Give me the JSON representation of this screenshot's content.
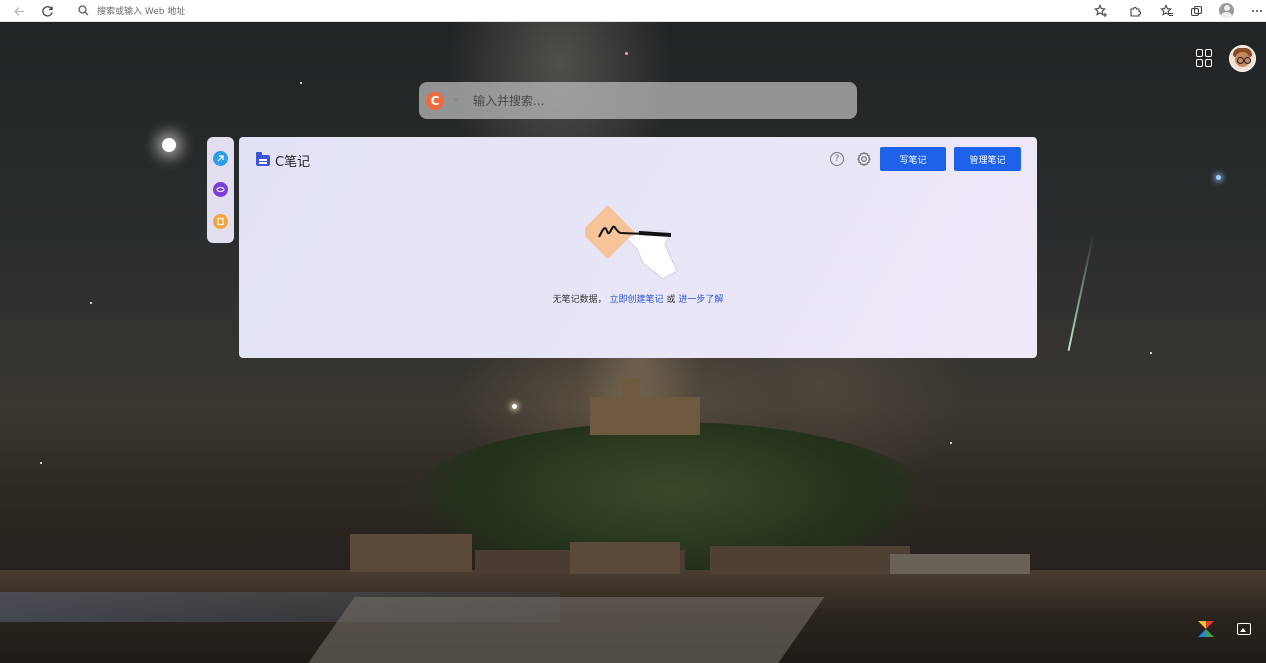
{
  "browser": {
    "address_placeholder": "搜索或输入 Web 地址",
    "icons": [
      "back-icon",
      "refresh-icon",
      "search-icon",
      "favorite-add-icon",
      "extensions-icon",
      "favorites-icon",
      "collections-icon",
      "profile-icon",
      "more-icon"
    ]
  },
  "search": {
    "engine_letter": "C",
    "placeholder": "输入并搜索..."
  },
  "sidebar": {
    "items": [
      "app-icon-blue",
      "app-icon-purple",
      "app-icon-orange"
    ]
  },
  "panel": {
    "title": "C笔记",
    "help_glyph": "?",
    "buttons": {
      "write": "写笔记",
      "manage": "管理笔记"
    },
    "empty": {
      "message": "无笔记数据，",
      "create_link": "立即创建笔记",
      "or": " 或 ",
      "learn_link": "进一步了解"
    }
  },
  "colors": {
    "accent": "#1e62ea",
    "link": "#2c55d8",
    "engine_logo": "#f06a3b",
    "panel_bg": "#e4e3f6"
  }
}
